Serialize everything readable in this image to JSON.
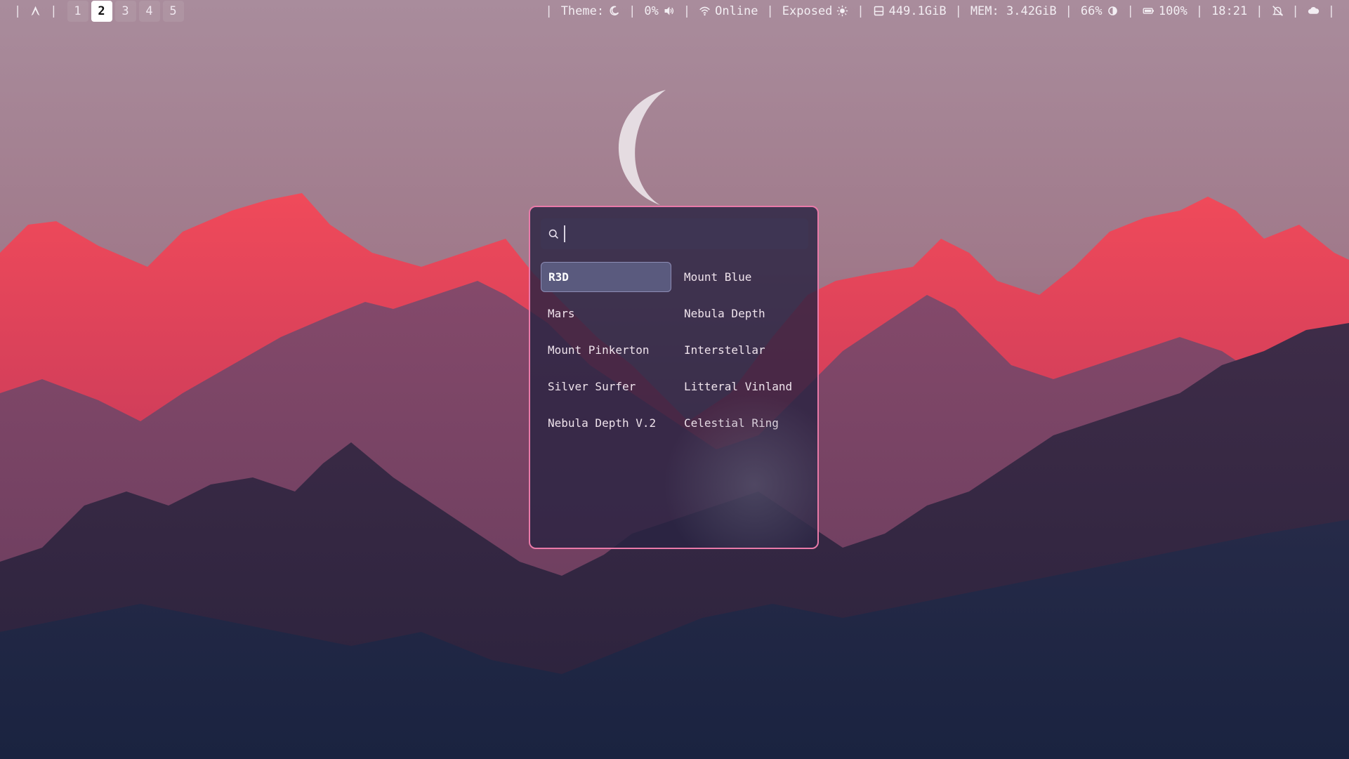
{
  "workspaces": {
    "items": [
      "1",
      "2",
      "3",
      "4",
      "5"
    ],
    "active": "2"
  },
  "status": {
    "separator": "|",
    "theme": "Theme:",
    "volume": "0%",
    "network": "Online",
    "mode": "Exposed",
    "disk": "449.1GiB",
    "memory": "MEM: 3.42GiB",
    "brightness": "66%",
    "battery": "100%",
    "clock": "18:21"
  },
  "launcher": {
    "search_value": "",
    "items": [
      "R3D",
      "Mount Blue",
      "Mars",
      "Nebula Depth",
      "Mount Pinkerton",
      "Interstellar",
      "Silver Surfer",
      "Litteral Vinland",
      "Nebula Depth V.2",
      "Celestial Ring"
    ],
    "selected": "R3D"
  },
  "colors": {
    "launcher_border": "#e97aa9",
    "launcher_bg": "#2a2342",
    "selected_item": "#5a5a7e",
    "bar_text": "#f3eef3"
  },
  "icons": {
    "launcher": "arch-logo-icon",
    "theme": "moon-icon",
    "volume": "speaker-icon",
    "network": "wifi-icon",
    "mode": "sun-icon",
    "disk": "disk-icon",
    "brightness": "half-circle-icon",
    "battery": "battery-icon",
    "notifications": "bell-off-icon",
    "tray": "cloud-icon",
    "search": "search-icon"
  }
}
